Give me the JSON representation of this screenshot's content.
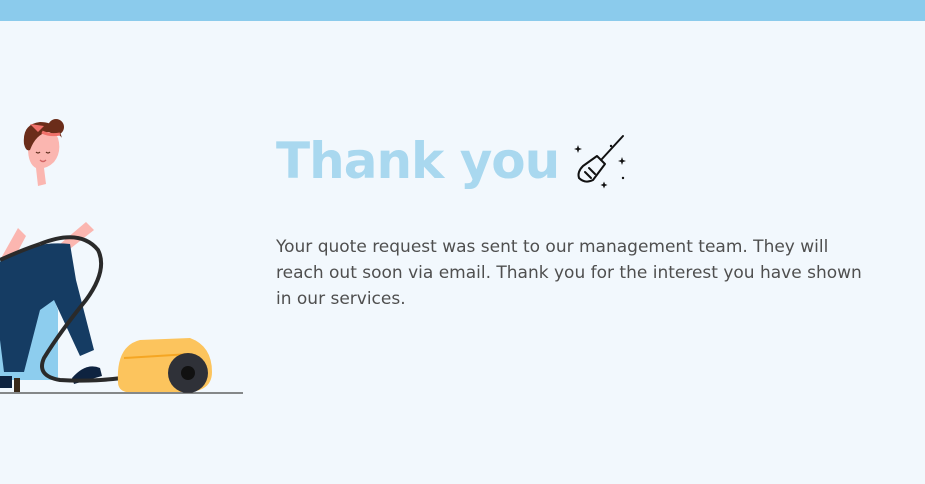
{
  "confirmation": {
    "heading": "Thank you",
    "message": "Your quote request was sent to our management team. They will reach out soon via email. Thank you for the interest you have shown in our services."
  },
  "icons": {
    "heading_icon": "broom-sparkle-icon",
    "illustration": "woman-vacuuming-illustration"
  },
  "colors": {
    "top_bar": "#8bcbec",
    "background": "#f2f8fd",
    "heading": "#a9d8ef",
    "text": "#4f4f4f",
    "vacuum": "#fcc45d"
  }
}
